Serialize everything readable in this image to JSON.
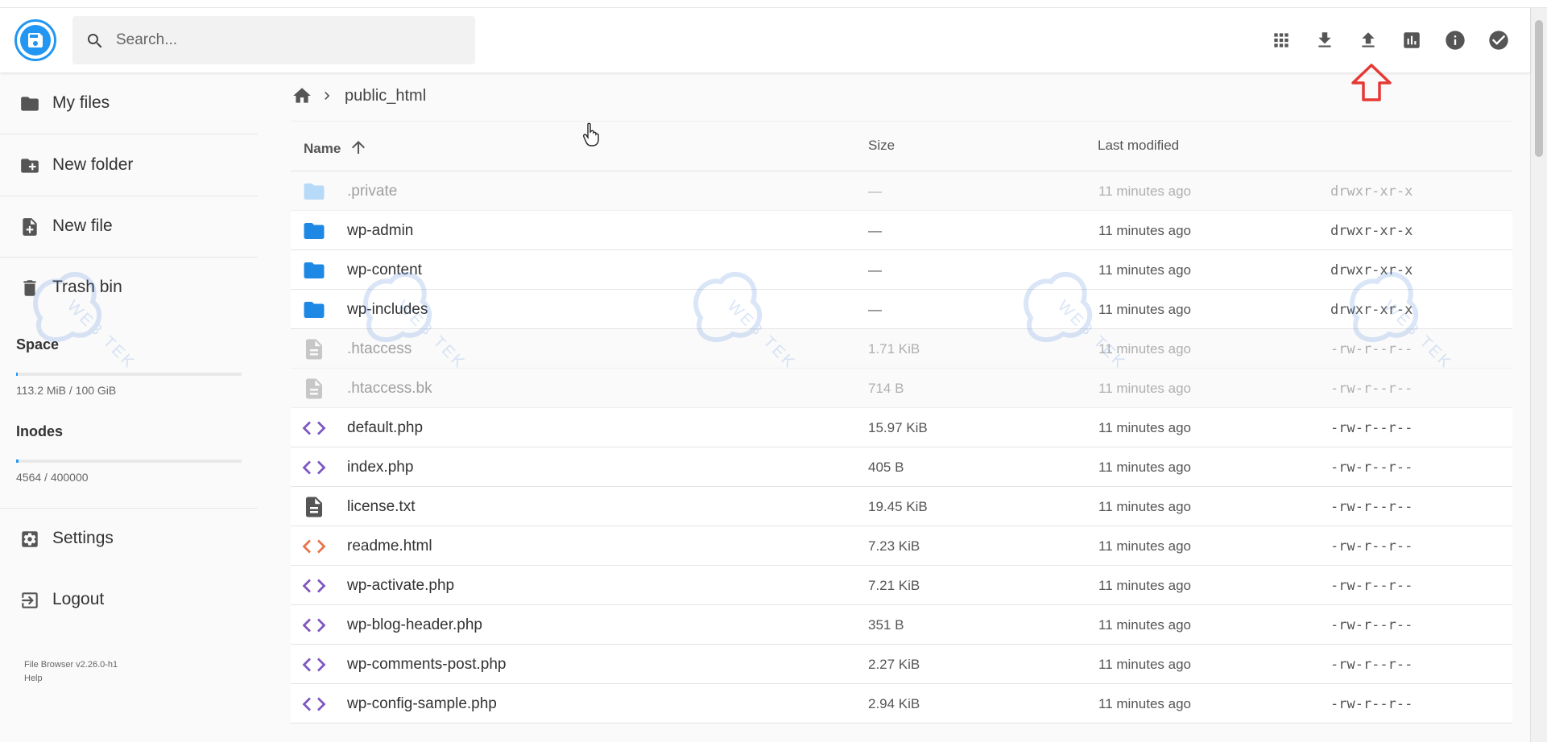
{
  "header": {
    "search_placeholder": "Search...",
    "actions": [
      "grid-view",
      "download",
      "upload",
      "disk-usage",
      "info",
      "select"
    ]
  },
  "sidebar": {
    "items": [
      {
        "label": "My files",
        "icon": "folder-icon"
      },
      {
        "label": "New folder",
        "icon": "create-folder-icon"
      },
      {
        "label": "New file",
        "icon": "note-add-icon"
      },
      {
        "label": "Trash bin",
        "icon": "trash-icon"
      }
    ],
    "space": {
      "title": "Space",
      "value": "113.2 MiB / 100 GiB",
      "fraction": 0.001
    },
    "inodes": {
      "title": "Inodes",
      "value": "4564 / 400000",
      "fraction": 0.011
    },
    "settings_label": "Settings",
    "logout_label": "Logout",
    "version": "File Browser v2.26.0-h1",
    "help": "Help"
  },
  "breadcrumb": {
    "current": "public_html"
  },
  "list": {
    "columns": {
      "name": "Name",
      "size": "Size",
      "modified": "Last modified"
    },
    "rows": [
      {
        "name": ".private",
        "size": "—",
        "modified": "11 minutes ago",
        "perm": "drwxr-xr-x",
        "kind": "folder",
        "dim": true
      },
      {
        "name": "wp-admin",
        "size": "—",
        "modified": "11 minutes ago",
        "perm": "drwxr-xr-x",
        "kind": "folder",
        "dim": false
      },
      {
        "name": "wp-content",
        "size": "—",
        "modified": "11 minutes ago",
        "perm": "drwxr-xr-x",
        "kind": "folder",
        "dim": false
      },
      {
        "name": "wp-includes",
        "size": "—",
        "modified": "11 minutes ago",
        "perm": "drwxr-xr-x",
        "kind": "folder",
        "dim": false
      },
      {
        "name": ".htaccess",
        "size": "1.71 KiB",
        "modified": "11 minutes ago",
        "perm": "-rw-r--r--",
        "kind": "doc-gray",
        "dim": true
      },
      {
        "name": ".htaccess.bk",
        "size": "714 B",
        "modified": "11 minutes ago",
        "perm": "-rw-r--r--",
        "kind": "doc-gray",
        "dim": true
      },
      {
        "name": "default.php",
        "size": "15.97 KiB",
        "modified": "11 minutes ago",
        "perm": "-rw-r--r--",
        "kind": "code-purple",
        "dim": false
      },
      {
        "name": "index.php",
        "size": "405 B",
        "modified": "11 minutes ago",
        "perm": "-rw-r--r--",
        "kind": "code-purple",
        "dim": false
      },
      {
        "name": "license.txt",
        "size": "19.45 KiB",
        "modified": "11 minutes ago",
        "perm": "-rw-r--r--",
        "kind": "doc-dark",
        "dim": false
      },
      {
        "name": "readme.html",
        "size": "7.23 KiB",
        "modified": "11 minutes ago",
        "perm": "-rw-r--r--",
        "kind": "code-orange",
        "dim": false
      },
      {
        "name": "wp-activate.php",
        "size": "7.21 KiB",
        "modified": "11 minutes ago",
        "perm": "-rw-r--r--",
        "kind": "code-purple",
        "dim": false
      },
      {
        "name": "wp-blog-header.php",
        "size": "351 B",
        "modified": "11 minutes ago",
        "perm": "-rw-r--r--",
        "kind": "code-purple",
        "dim": false
      },
      {
        "name": "wp-comments-post.php",
        "size": "2.27 KiB",
        "modified": "11 minutes ago",
        "perm": "-rw-r--r--",
        "kind": "code-purple",
        "dim": false
      },
      {
        "name": "wp-config-sample.php",
        "size": "2.94 KiB",
        "modified": "11 minutes ago",
        "perm": "-rw-r--r--",
        "kind": "code-purple",
        "dim": false
      }
    ]
  },
  "watermark": {
    "text": "WEB TEK"
  },
  "colors": {
    "accent": "#2196f3",
    "folder": "#1e88e5",
    "code_purple": "#7e57c2",
    "code_orange": "#e8734a",
    "annotation": "#e53935"
  }
}
